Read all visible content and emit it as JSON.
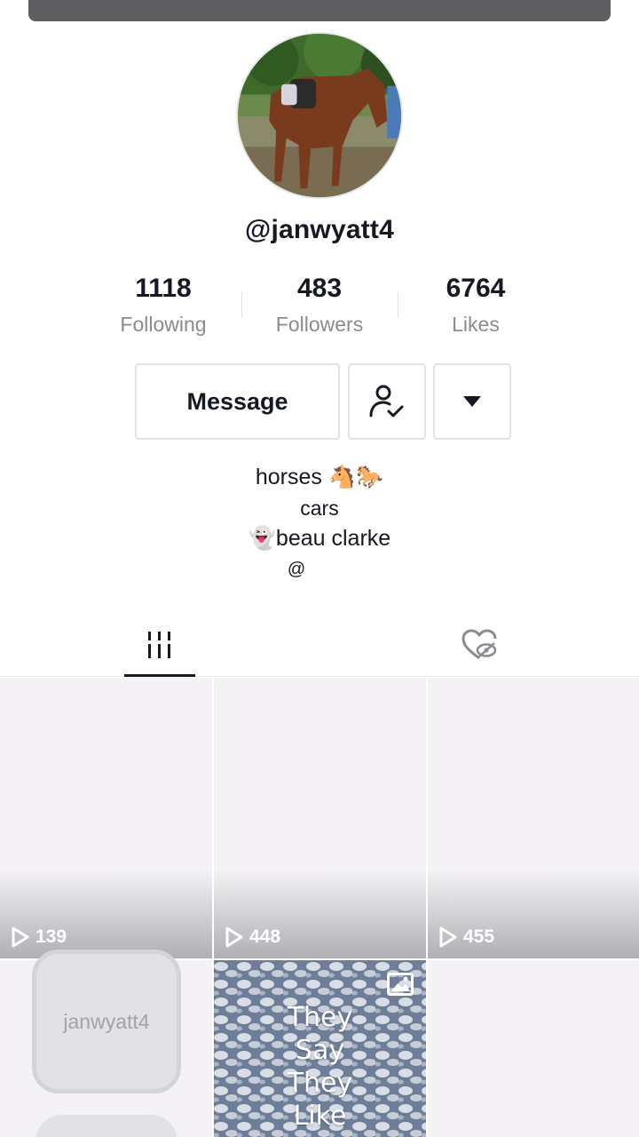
{
  "profile": {
    "username": "@janwyatt4",
    "avatar_icon": "horse-photo"
  },
  "stats": [
    {
      "value": "1118",
      "label": "Following"
    },
    {
      "value": "483",
      "label": "Followers"
    },
    {
      "value": "6764",
      "label": "Likes"
    }
  ],
  "actions": {
    "message_label": "Message",
    "follow_icon": "person-check-icon",
    "more_icon": "caret-down-icon"
  },
  "bio": {
    "line1": "horses 🐴🐎",
    "line2": "cars",
    "line3": "👻beau clarke",
    "line4": "@"
  },
  "tabs": [
    {
      "name": "videos",
      "icon": "grid-bars-icon",
      "selected": true
    },
    {
      "name": "liked",
      "icon": "heart-hidden-icon",
      "selected": false
    }
  ],
  "videos": [
    {
      "plays": "139"
    },
    {
      "plays": "448"
    },
    {
      "plays": "455"
    }
  ],
  "watermark": "janwyatt4",
  "photo_post": {
    "line1": "They",
    "line2": "Say",
    "line3": "They",
    "line4": "Like"
  },
  "colors": {
    "text": "#161823",
    "muted": "#8a8b91",
    "border": "#e3e3e4",
    "tile": "#f4f2f5"
  }
}
